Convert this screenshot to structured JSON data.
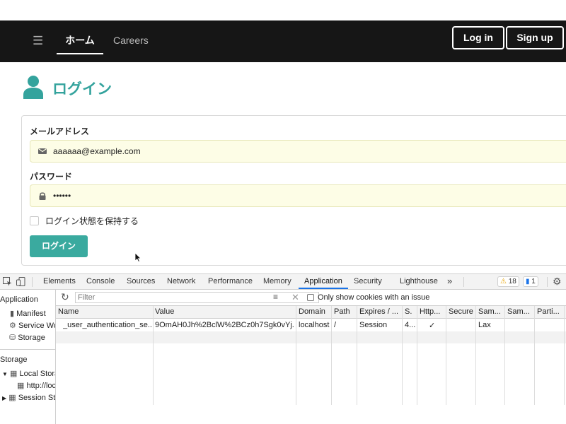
{
  "navbar": {
    "menu_icon": "hamburger-icon",
    "home": "ホーム",
    "careers": "Careers",
    "login": "Log in",
    "signup": "Sign up"
  },
  "login_page": {
    "title": "ログイン",
    "email_label": "メールアドレス",
    "email_value": "aaaaaa@example.com",
    "password_label": "パスワード",
    "password_value": "••••••",
    "remember_label": "ログイン状態を保持する",
    "submit_label": "ログイン"
  },
  "colors": {
    "accent": "#34a39d",
    "navbar_bg": "#161616",
    "autofill_bg": "#fdfde6",
    "devtools_active": "#1a73e8"
  },
  "devtools": {
    "tabs": [
      "Elements",
      "Console",
      "Sources",
      "Network",
      "Performance",
      "Memory",
      "Application",
      "Security",
      "Lighthouse"
    ],
    "active_tab": "Application",
    "more": "»",
    "warnings_count": "18",
    "messages_count": "1",
    "sidebar": {
      "application_header": "Application",
      "application_items": [
        "Manifest",
        "Service Wo",
        "Storage"
      ],
      "storage_header": "Storage",
      "storage_items": [
        "Local Stora",
        "http://loc",
        "Session St"
      ]
    },
    "filter": {
      "placeholder": "Filter",
      "only_issues_label": "Only show cookies with an issue"
    },
    "cookie_table": {
      "headers": [
        "Name",
        "Value",
        "Domain",
        "Path",
        "Expires / ...",
        "S.",
        "Http...",
        "Secure",
        "Sam...",
        "Sam...",
        "Parti..."
      ],
      "rows": [
        [
          "_user_authentication_se...",
          "9OmAH0Jh%2BclW%2BCz0h7Sgk0vYj...",
          "localhost",
          "/",
          "Session",
          "4...",
          "✓",
          "",
          "Lax",
          "",
          ""
        ]
      ]
    }
  }
}
